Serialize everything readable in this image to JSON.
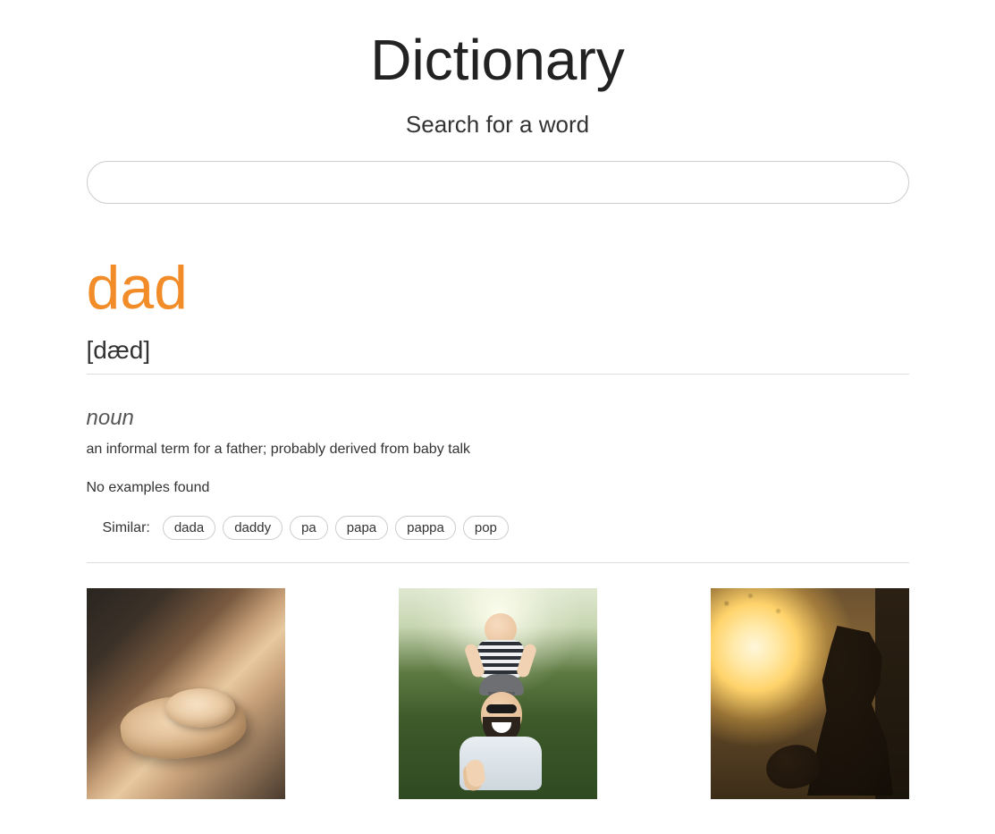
{
  "header": {
    "title": "Dictionary",
    "search_label": "Search for a word"
  },
  "search": {
    "value": "",
    "placeholder": ""
  },
  "entry": {
    "word": "dad",
    "pronunciation": "[dæd]",
    "part_of_speech": "noun",
    "definition": "an informal term for a father; probably derived from baby talk",
    "examples_text": "No examples found",
    "similar_label": "Similar:",
    "synonyms": [
      "dada",
      "daddy",
      "pa",
      "papa",
      "pappa",
      "pop"
    ]
  },
  "colors": {
    "accent": "#f28c28"
  },
  "images": [
    {
      "name": "result-image-1",
      "alt": "adult hand holding child's hand"
    },
    {
      "name": "result-image-2",
      "alt": "father with smiling child on shoulders giving thumbs up"
    },
    {
      "name": "result-image-3",
      "alt": "silhouette of parent holding baby at sunset"
    }
  ]
}
